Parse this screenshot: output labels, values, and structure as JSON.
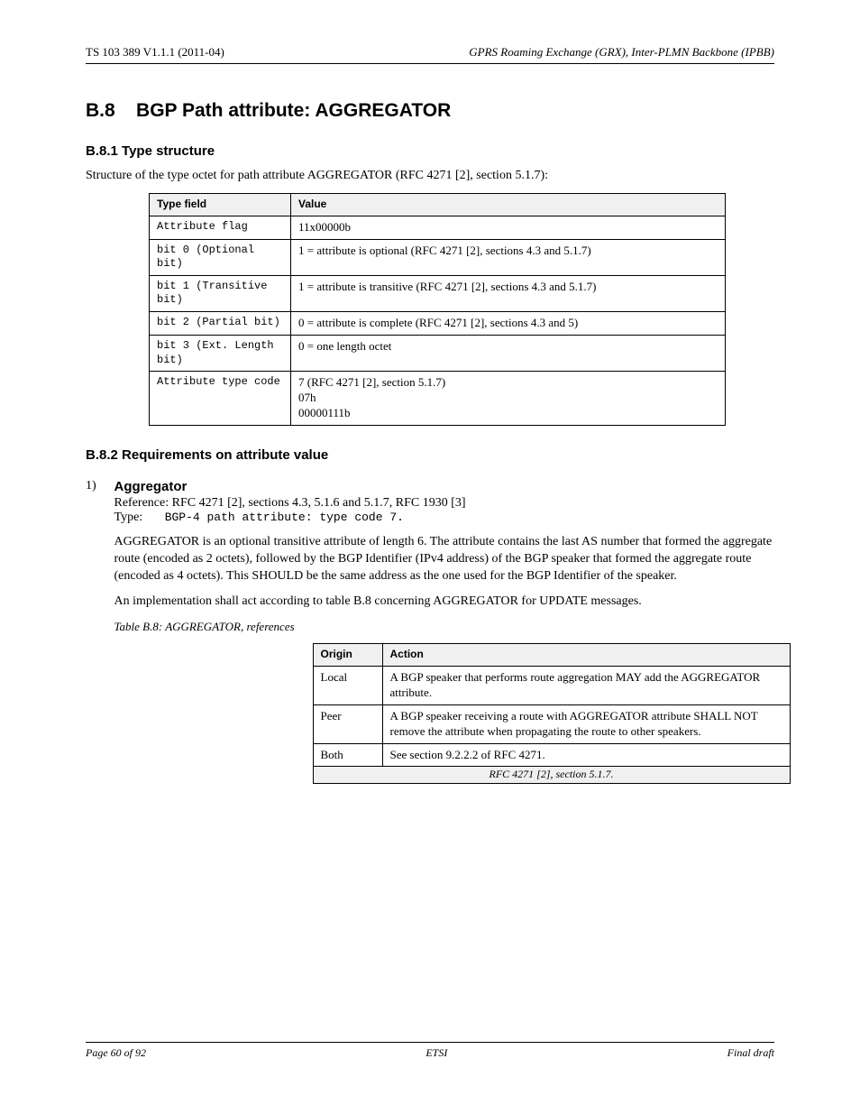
{
  "header": {
    "left": "TS 103 389 V1.1.1 (2011-04)",
    "right": "GPRS Roaming Exchange (GRX), Inter-PLMN Backbone (IPBB)"
  },
  "section": {
    "number": "B.8",
    "title": "BGP Path attribute: AGGREGATOR"
  },
  "sub_b81": {
    "title": "B.8.1    Type structure",
    "intro": "Structure of the type octet for path attribute AGGREGATOR (RFC 4271 [2], section 5.1.7):",
    "table": {
      "headers": [
        "Type field",
        "Value"
      ],
      "rows": [
        [
          "Attribute flag",
          "11x00000b"
        ],
        [
          "bit 0 (Optional bit)",
          "1 = attribute is optional (RFC 4271 [2], sections 4.3 and 5.1.7)"
        ],
        [
          "bit 1 (Transitive bit)",
          "1 = attribute is transitive (RFC 4271 [2], sections 4.3 and 5.1.7)"
        ],
        [
          "bit 2 (Partial bit)",
          "0 = attribute is complete (RFC 4271 [2], sections 4.3 and 5)"
        ],
        [
          "bit 3 (Ext. Length bit)",
          "0 = one length octet"
        ],
        [
          "Attribute type code",
          "7 (RFC 4271 [2], section 5.1.7)\n07h\n00000111b"
        ]
      ]
    }
  },
  "sub_b82": {
    "title": "B.8.2    Requirements on attribute value",
    "item_num": "1)",
    "item_title": "Aggregator",
    "ref": "RFC 4271 [2], sections 4.3, 5.1.6 and 5.1.7, RFC 1930 [3]",
    "type": "BGP-4 path attribute: type code 7.",
    "para1": "AGGREGATOR is an optional transitive attribute of length 6. The attribute contains the last AS number that formed the aggregate route (encoded as 2 octets), followed by the BGP Identifier (IPv4 address) of the BGP speaker that formed the aggregate route (encoded as 4 octets). This SHOULD be the same address as the one used for the BGP Identifier of the speaker.",
    "para2_prefix": "An implementation shall act according to table B.8 concerning AGGREGATOR for UPDATE messages.",
    "ref_table": {
      "caption": "Table B.8: AGGREGATOR, references",
      "headers": [
        "Origin",
        "Action"
      ],
      "rows": [
        [
          "Local",
          "A BGP speaker that performs route aggregation MAY add the AGGREGATOR attribute."
        ],
        [
          "Peer",
          "A BGP speaker receiving a route with AGGREGATOR attribute SHALL NOT remove the attribute when propagating the route to other speakers."
        ],
        [
          "Both",
          "See section 9.2.2.2 of RFC 4271."
        ]
      ],
      "span": "RFC 4271 [2], section 5.1.7."
    }
  },
  "footer": {
    "left": "Page 60 of 92",
    "center": "ETSI",
    "right": "Final draft"
  }
}
